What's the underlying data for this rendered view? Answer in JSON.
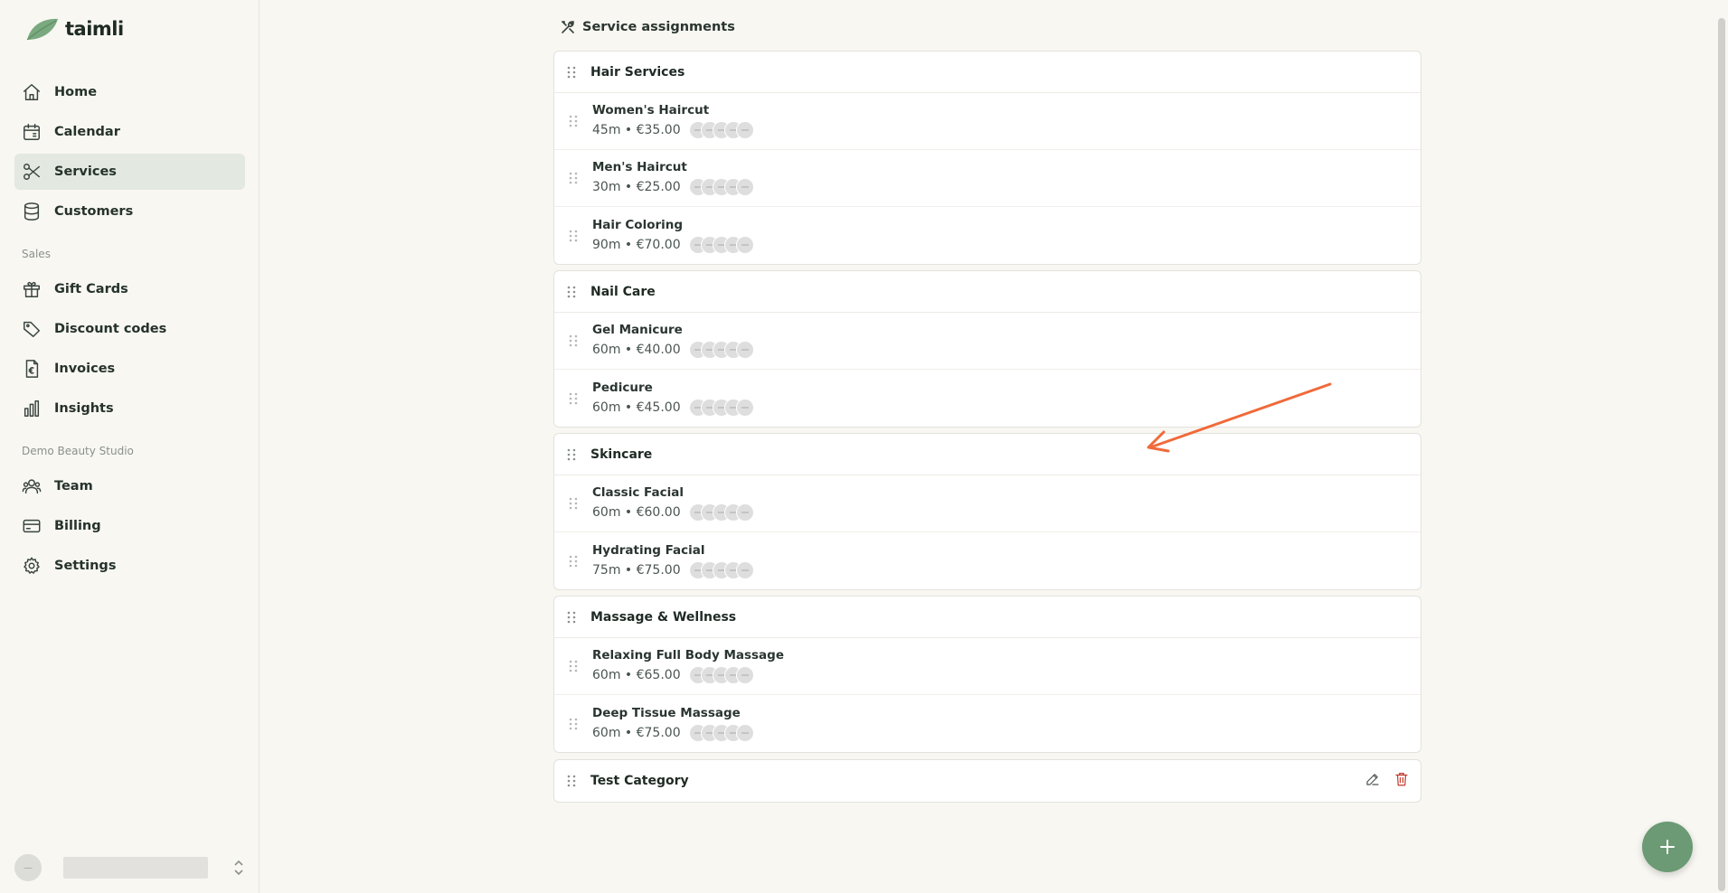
{
  "app": {
    "logo_text": "taimli"
  },
  "sidebar": {
    "main_items": [
      {
        "label": "Home",
        "icon": "home-icon"
      },
      {
        "label": "Calendar",
        "icon": "calendar-icon"
      },
      {
        "label": "Services",
        "icon": "scissors-icon",
        "active": true
      },
      {
        "label": "Customers",
        "icon": "database-icon"
      }
    ],
    "sales_section": "Sales",
    "sales_items": [
      {
        "label": "Gift Cards",
        "icon": "gift-icon"
      },
      {
        "label": "Discount codes",
        "icon": "tag-icon"
      },
      {
        "label": "Invoices",
        "icon": "invoice-icon"
      },
      {
        "label": "Insights",
        "icon": "bar-chart-icon"
      }
    ],
    "studio_section": "Demo Beauty Studio",
    "studio_items": [
      {
        "label": "Team",
        "icon": "team-icon"
      },
      {
        "label": "Billing",
        "icon": "credit-card-icon"
      },
      {
        "label": "Settings",
        "icon": "gear-icon"
      }
    ]
  },
  "main": {
    "header": "Service assignments",
    "categories": [
      {
        "title": "Hair Services",
        "services": [
          {
            "name": "Women's Haircut",
            "meta": "45m • €35.00"
          },
          {
            "name": "Men's Haircut",
            "meta": "30m • €25.00"
          },
          {
            "name": "Hair Coloring",
            "meta": "90m • €70.00"
          }
        ]
      },
      {
        "title": "Nail Care",
        "services": [
          {
            "name": "Gel Manicure",
            "meta": "60m • €40.00"
          },
          {
            "name": "Pedicure",
            "meta": "60m • €45.00"
          }
        ]
      },
      {
        "title": "Skincare",
        "services": [
          {
            "name": "Classic Facial",
            "meta": "60m • €60.00"
          },
          {
            "name": "Hydrating Facial",
            "meta": "75m • €75.00"
          }
        ]
      },
      {
        "title": "Massage & Wellness",
        "services": [
          {
            "name": "Relaxing Full Body Massage",
            "meta": "60m • €65.00"
          },
          {
            "name": "Deep Tissue Massage",
            "meta": "60m • €75.00"
          }
        ]
      },
      {
        "title": "Test Category",
        "services": []
      }
    ]
  },
  "colors": {
    "accent": "#6b9a74",
    "active_bg": "#e3e8e1",
    "annotation_arrow": "#f06a3a",
    "delete": "#c0392b"
  }
}
